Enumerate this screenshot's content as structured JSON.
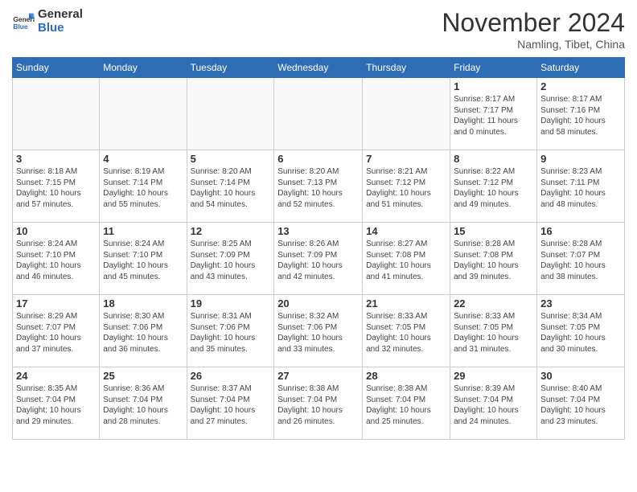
{
  "header": {
    "logo_general": "General",
    "logo_blue": "Blue",
    "month": "November 2024",
    "location": "Namling, Tibet, China"
  },
  "weekdays": [
    "Sunday",
    "Monday",
    "Tuesday",
    "Wednesday",
    "Thursday",
    "Friday",
    "Saturday"
  ],
  "weeks": [
    [
      {
        "day": "",
        "info": ""
      },
      {
        "day": "",
        "info": ""
      },
      {
        "day": "",
        "info": ""
      },
      {
        "day": "",
        "info": ""
      },
      {
        "day": "",
        "info": ""
      },
      {
        "day": "1",
        "info": "Sunrise: 8:17 AM\nSunset: 7:17 PM\nDaylight: 11 hours\nand 0 minutes."
      },
      {
        "day": "2",
        "info": "Sunrise: 8:17 AM\nSunset: 7:16 PM\nDaylight: 10 hours\nand 58 minutes."
      }
    ],
    [
      {
        "day": "3",
        "info": "Sunrise: 8:18 AM\nSunset: 7:15 PM\nDaylight: 10 hours\nand 57 minutes."
      },
      {
        "day": "4",
        "info": "Sunrise: 8:19 AM\nSunset: 7:14 PM\nDaylight: 10 hours\nand 55 minutes."
      },
      {
        "day": "5",
        "info": "Sunrise: 8:20 AM\nSunset: 7:14 PM\nDaylight: 10 hours\nand 54 minutes."
      },
      {
        "day": "6",
        "info": "Sunrise: 8:20 AM\nSunset: 7:13 PM\nDaylight: 10 hours\nand 52 minutes."
      },
      {
        "day": "7",
        "info": "Sunrise: 8:21 AM\nSunset: 7:12 PM\nDaylight: 10 hours\nand 51 minutes."
      },
      {
        "day": "8",
        "info": "Sunrise: 8:22 AM\nSunset: 7:12 PM\nDaylight: 10 hours\nand 49 minutes."
      },
      {
        "day": "9",
        "info": "Sunrise: 8:23 AM\nSunset: 7:11 PM\nDaylight: 10 hours\nand 48 minutes."
      }
    ],
    [
      {
        "day": "10",
        "info": "Sunrise: 8:24 AM\nSunset: 7:10 PM\nDaylight: 10 hours\nand 46 minutes."
      },
      {
        "day": "11",
        "info": "Sunrise: 8:24 AM\nSunset: 7:10 PM\nDaylight: 10 hours\nand 45 minutes."
      },
      {
        "day": "12",
        "info": "Sunrise: 8:25 AM\nSunset: 7:09 PM\nDaylight: 10 hours\nand 43 minutes."
      },
      {
        "day": "13",
        "info": "Sunrise: 8:26 AM\nSunset: 7:09 PM\nDaylight: 10 hours\nand 42 minutes."
      },
      {
        "day": "14",
        "info": "Sunrise: 8:27 AM\nSunset: 7:08 PM\nDaylight: 10 hours\nand 41 minutes."
      },
      {
        "day": "15",
        "info": "Sunrise: 8:28 AM\nSunset: 7:08 PM\nDaylight: 10 hours\nand 39 minutes."
      },
      {
        "day": "16",
        "info": "Sunrise: 8:28 AM\nSunset: 7:07 PM\nDaylight: 10 hours\nand 38 minutes."
      }
    ],
    [
      {
        "day": "17",
        "info": "Sunrise: 8:29 AM\nSunset: 7:07 PM\nDaylight: 10 hours\nand 37 minutes."
      },
      {
        "day": "18",
        "info": "Sunrise: 8:30 AM\nSunset: 7:06 PM\nDaylight: 10 hours\nand 36 minutes."
      },
      {
        "day": "19",
        "info": "Sunrise: 8:31 AM\nSunset: 7:06 PM\nDaylight: 10 hours\nand 35 minutes."
      },
      {
        "day": "20",
        "info": "Sunrise: 8:32 AM\nSunset: 7:06 PM\nDaylight: 10 hours\nand 33 minutes."
      },
      {
        "day": "21",
        "info": "Sunrise: 8:33 AM\nSunset: 7:05 PM\nDaylight: 10 hours\nand 32 minutes."
      },
      {
        "day": "22",
        "info": "Sunrise: 8:33 AM\nSunset: 7:05 PM\nDaylight: 10 hours\nand 31 minutes."
      },
      {
        "day": "23",
        "info": "Sunrise: 8:34 AM\nSunset: 7:05 PM\nDaylight: 10 hours\nand 30 minutes."
      }
    ],
    [
      {
        "day": "24",
        "info": "Sunrise: 8:35 AM\nSunset: 7:04 PM\nDaylight: 10 hours\nand 29 minutes."
      },
      {
        "day": "25",
        "info": "Sunrise: 8:36 AM\nSunset: 7:04 PM\nDaylight: 10 hours\nand 28 minutes."
      },
      {
        "day": "26",
        "info": "Sunrise: 8:37 AM\nSunset: 7:04 PM\nDaylight: 10 hours\nand 27 minutes."
      },
      {
        "day": "27",
        "info": "Sunrise: 8:38 AM\nSunset: 7:04 PM\nDaylight: 10 hours\nand 26 minutes."
      },
      {
        "day": "28",
        "info": "Sunrise: 8:38 AM\nSunset: 7:04 PM\nDaylight: 10 hours\nand 25 minutes."
      },
      {
        "day": "29",
        "info": "Sunrise: 8:39 AM\nSunset: 7:04 PM\nDaylight: 10 hours\nand 24 minutes."
      },
      {
        "day": "30",
        "info": "Sunrise: 8:40 AM\nSunset: 7:04 PM\nDaylight: 10 hours\nand 23 minutes."
      }
    ]
  ]
}
